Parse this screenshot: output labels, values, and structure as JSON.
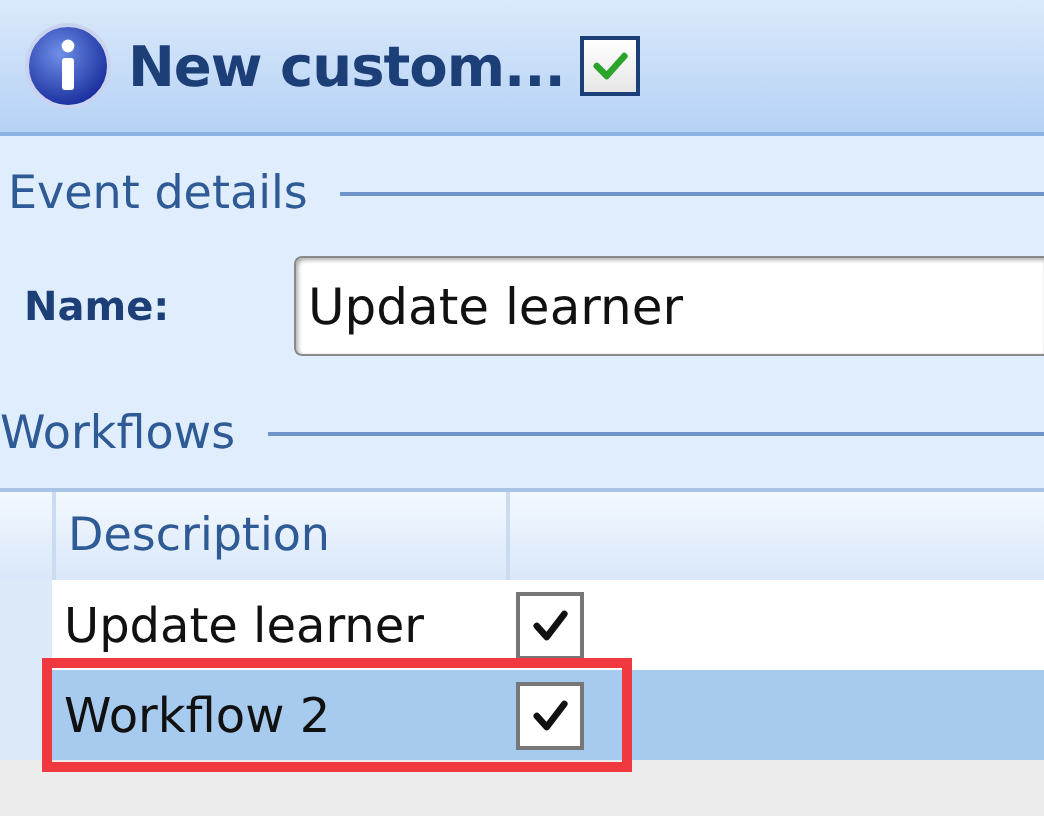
{
  "window": {
    "title": "New custom...",
    "title_checked": true
  },
  "event_details": {
    "heading": "Event details",
    "name_label": "Name:",
    "name_value": "Update learner"
  },
  "workflows": {
    "heading": "Workflows",
    "columns": [
      "Description"
    ],
    "rows": [
      {
        "description": "Update learner",
        "checked": true,
        "selected": false,
        "highlighted": false
      },
      {
        "description": "Workflow 2",
        "checked": true,
        "selected": true,
        "highlighted": true
      }
    ]
  }
}
